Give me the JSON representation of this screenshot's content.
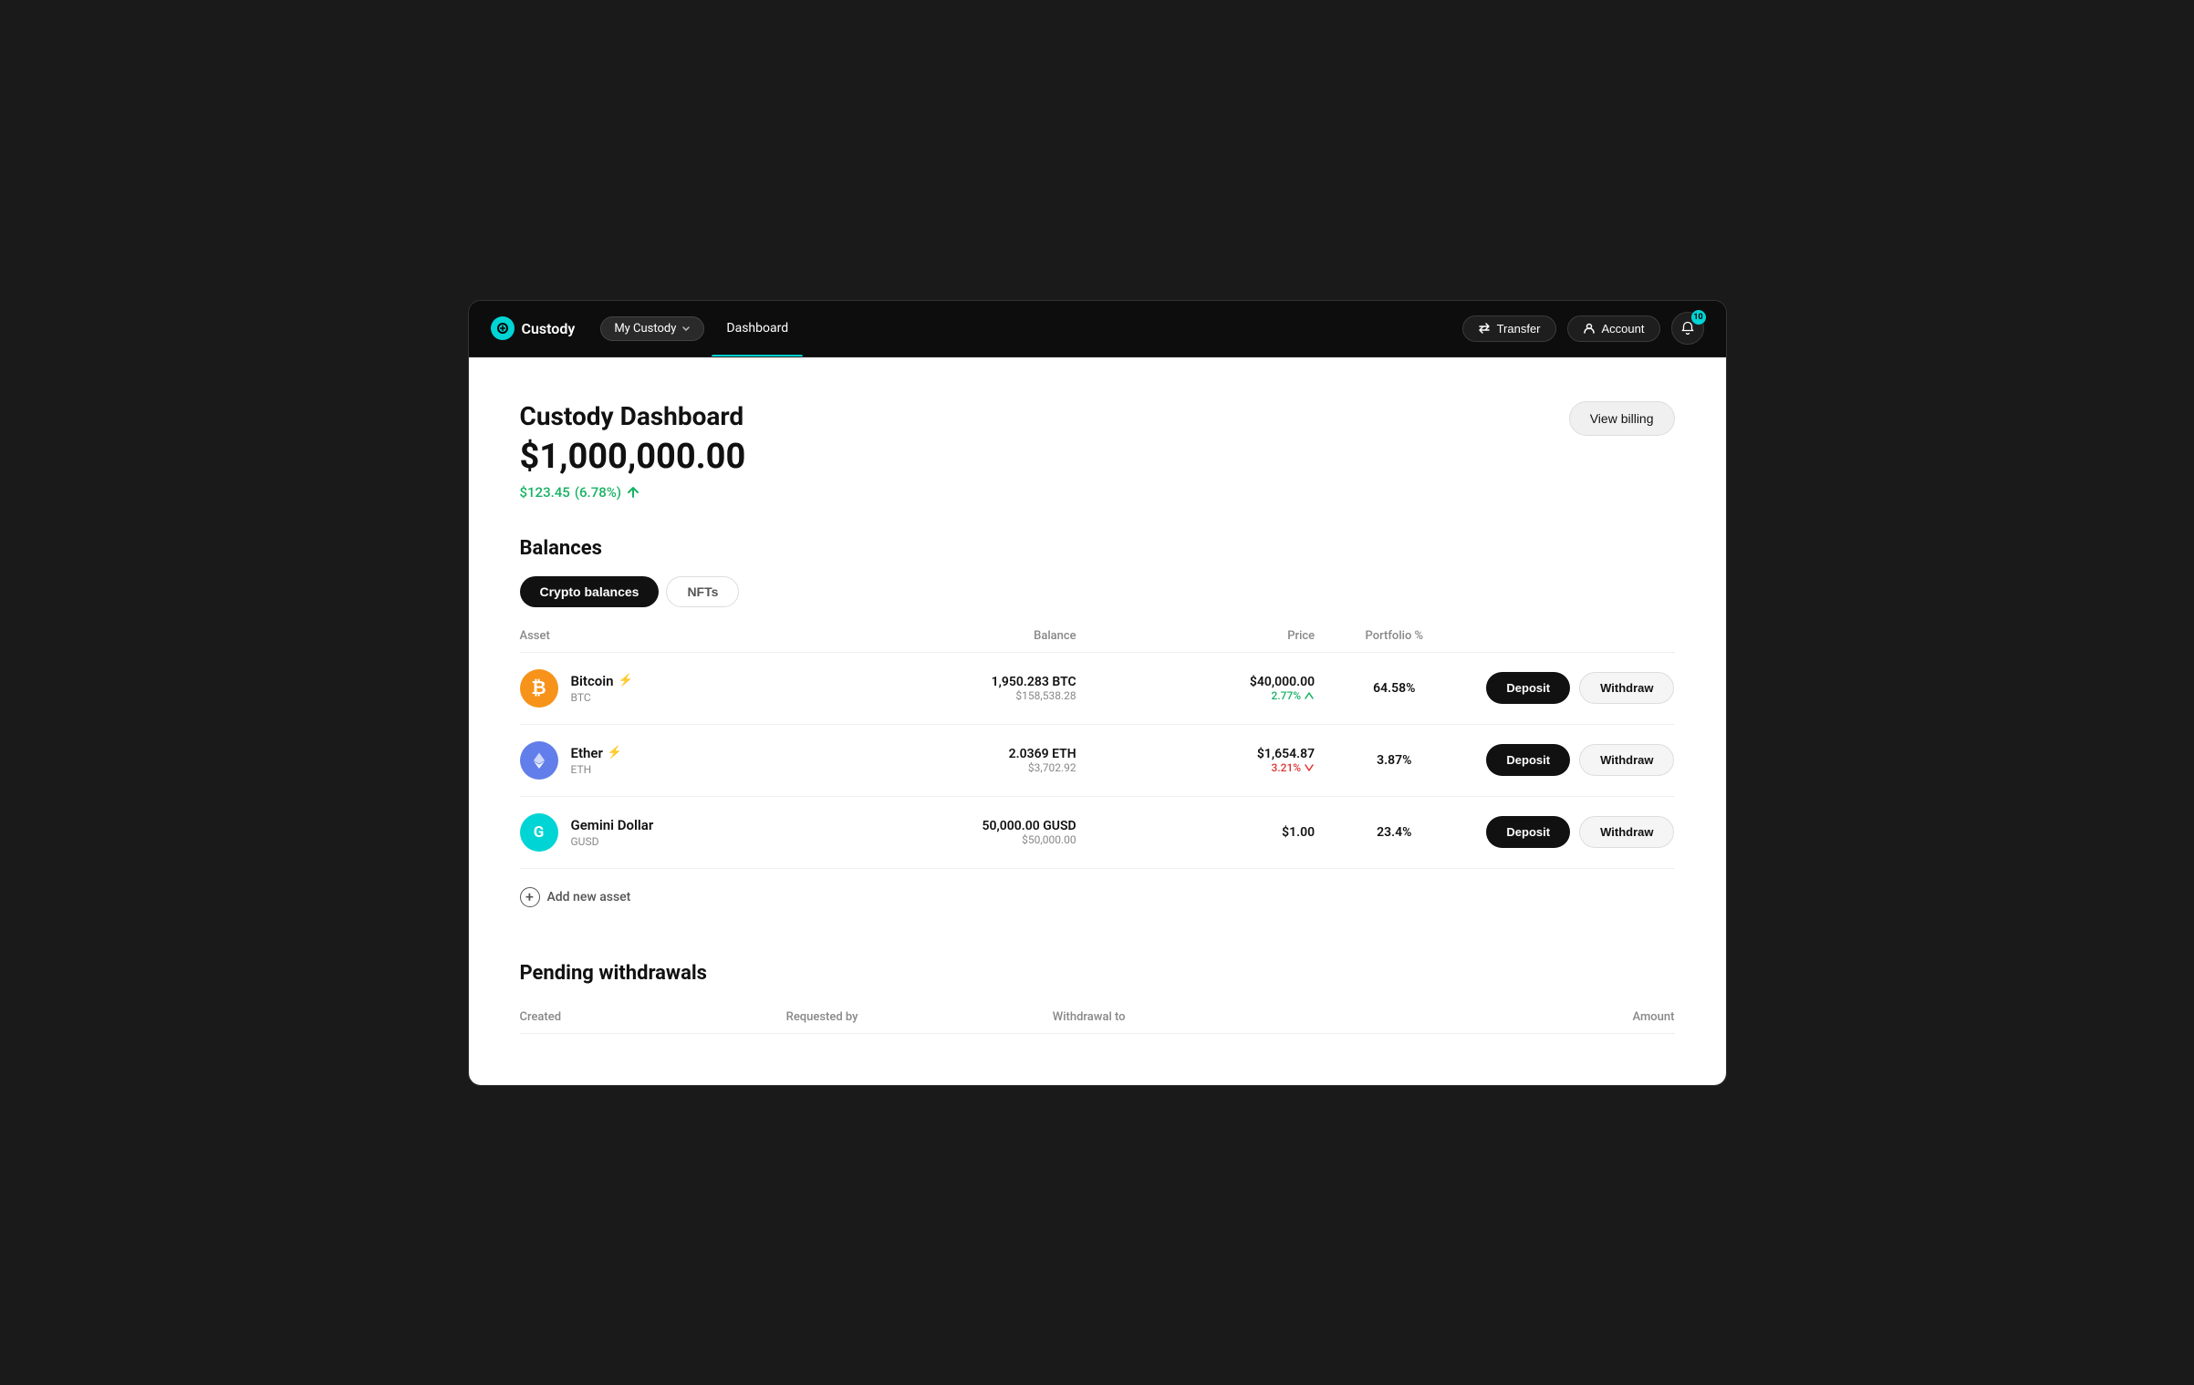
{
  "nav": {
    "logo_text": "Custody",
    "my_custody": "My Custody",
    "tab_dashboard": "Dashboard",
    "transfer_label": "Transfer",
    "account_label": "Account",
    "notification_count": "10"
  },
  "header": {
    "title": "Custody Dashboard",
    "amount": "$1,000,000.00",
    "change_amount": "$123.45",
    "change_pct": "(6.78%)",
    "view_billing": "View billing"
  },
  "balances": {
    "section_title": "Balances",
    "tab_crypto": "Crypto balances",
    "tab_nfts": "NFTs",
    "columns": {
      "asset": "Asset",
      "balance": "Balance",
      "price": "Price",
      "portfolio": "Portfolio %"
    },
    "rows": [
      {
        "icon_type": "btc",
        "icon_symbol": "₿",
        "name": "Bitcoin",
        "ticker": "BTC",
        "has_lightning": true,
        "balance_main": "1,950.283 BTC",
        "balance_sub": "$158,538.28",
        "price_main": "$40,000.00",
        "price_change": "2.77%",
        "price_direction": "up",
        "portfolio_pct": "64.58%",
        "deposit_label": "Deposit",
        "withdraw_label": "Withdraw"
      },
      {
        "icon_type": "eth",
        "icon_symbol": "◆",
        "name": "Ether",
        "ticker": "ETH",
        "has_lightning": true,
        "balance_main": "2.0369 ETH",
        "balance_sub": "$3,702.92",
        "price_main": "$1,654.87",
        "price_change": "3.21%",
        "price_direction": "down",
        "portfolio_pct": "3.87%",
        "deposit_label": "Deposit",
        "withdraw_label": "Withdraw"
      },
      {
        "icon_type": "gusd",
        "icon_symbol": "G",
        "name": "Gemini Dollar",
        "ticker": "GUSD",
        "has_lightning": false,
        "balance_main": "50,000.00 GUSD",
        "balance_sub": "$50,000.00",
        "price_main": "$1.00",
        "price_change": "",
        "price_direction": "none",
        "portfolio_pct": "23.4%",
        "deposit_label": "Deposit",
        "withdraw_label": "Withdraw"
      }
    ],
    "add_asset_label": "Add new asset"
  },
  "pending": {
    "section_title": "Pending withdrawals",
    "columns": {
      "created": "Created",
      "requested_by": "Requested by",
      "withdrawal_to": "Withdrawal to",
      "amount": "Amount"
    }
  }
}
